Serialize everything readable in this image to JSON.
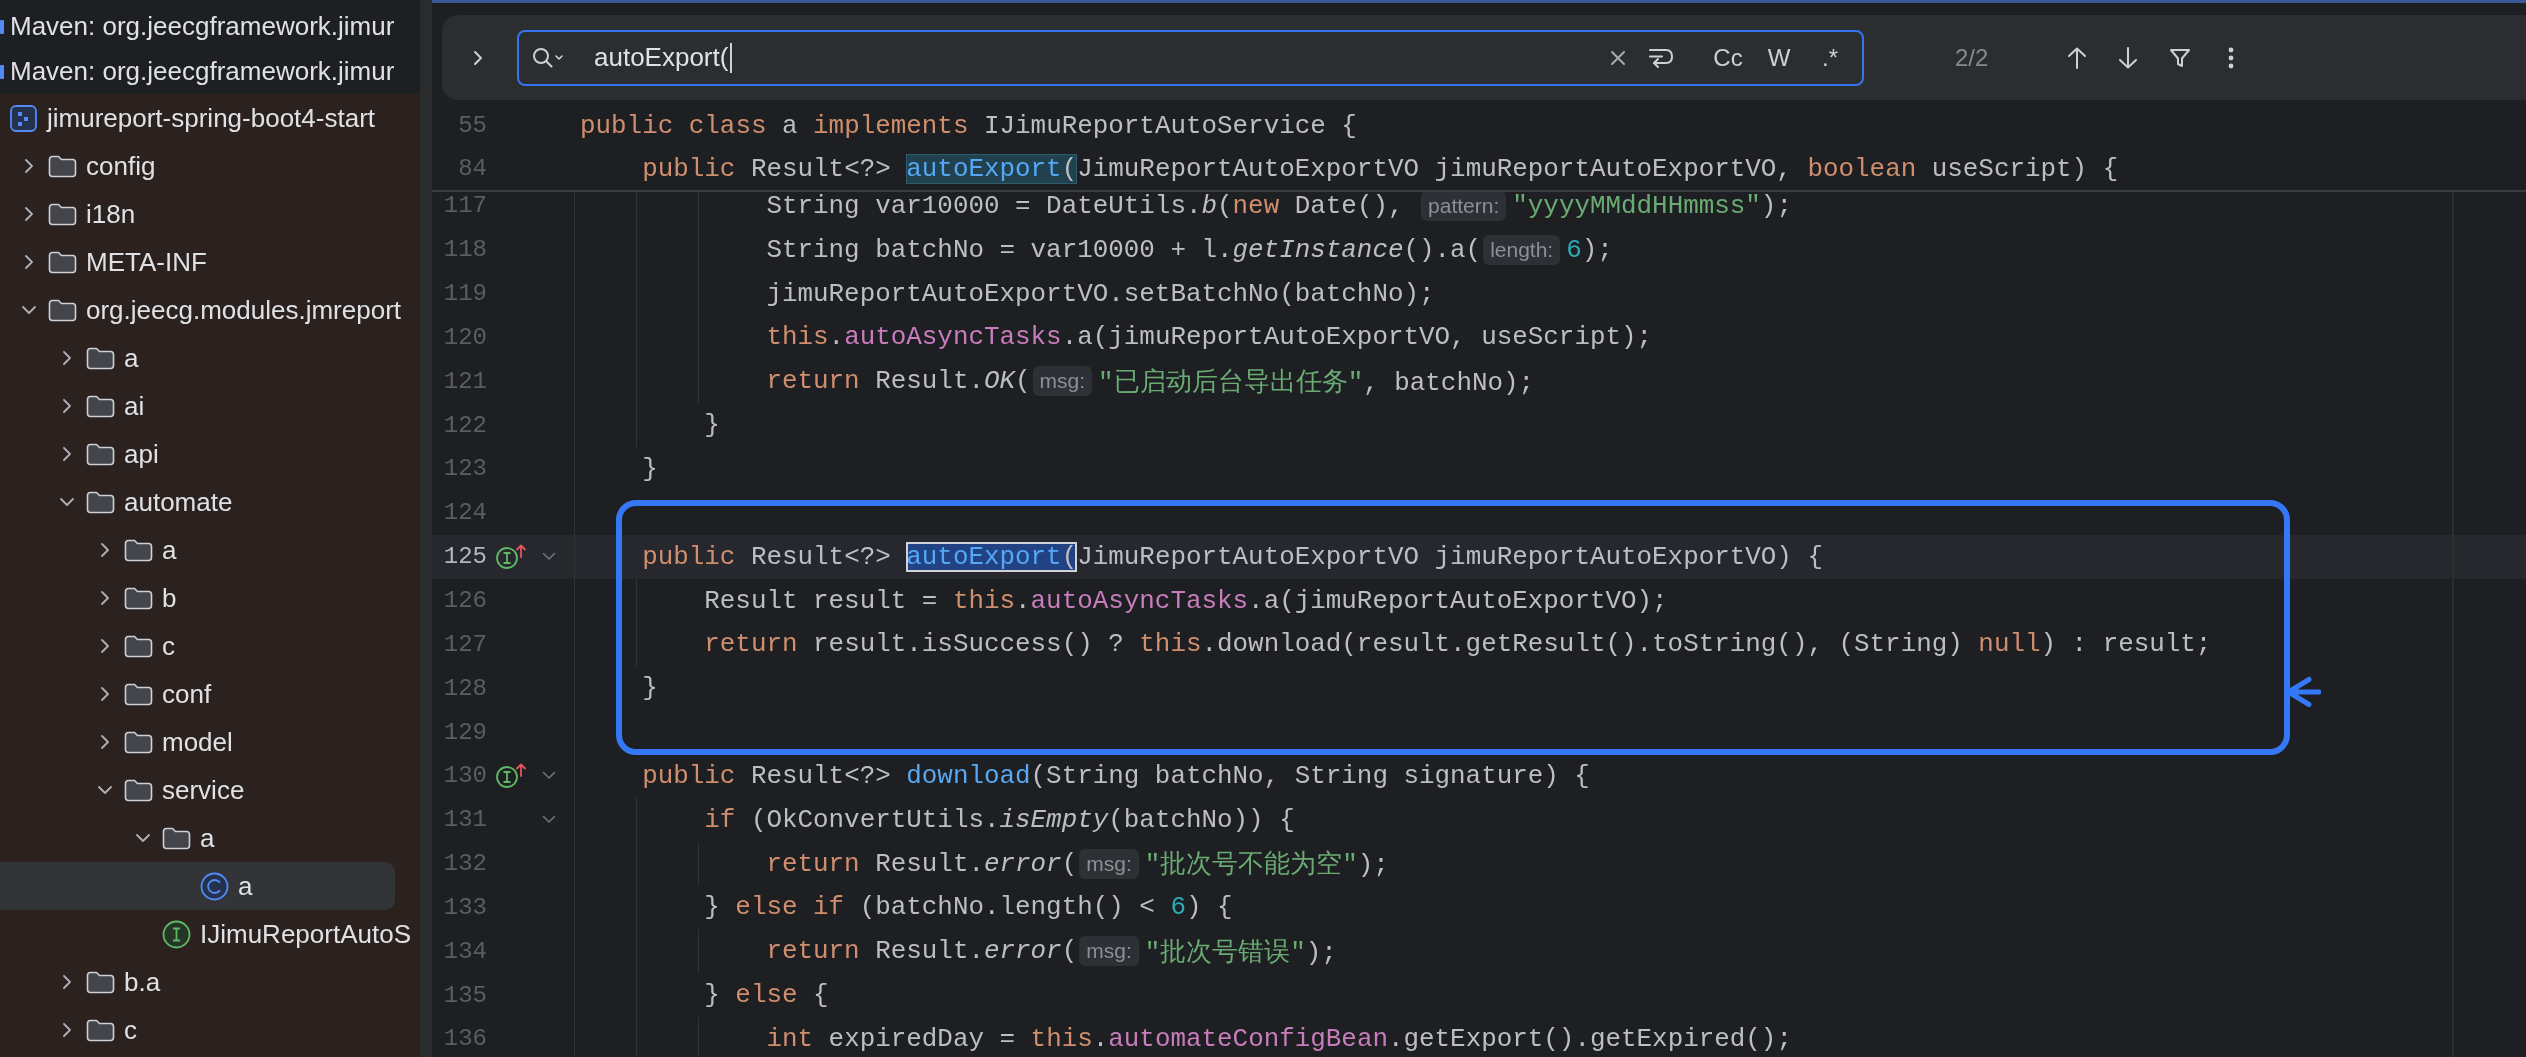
{
  "sidebar": {
    "items": [
      {
        "kind": "library",
        "label": "Maven: org.jeecgframework.jimur",
        "selected": false
      },
      {
        "kind": "library",
        "label": "Maven: org.jeecgframework.jimur",
        "selected": false,
        "children": [
          {
            "kind": "archive",
            "label": "jimureport-spring-boot4-start",
            "selected": false,
            "color": "#2b2220",
            "children": [
              {
                "kind": "folder",
                "label": "config",
                "expanded": false,
                "selected": false
              },
              {
                "kind": "folder",
                "label": "i18n",
                "expanded": false,
                "selected": false
              },
              {
                "kind": "folder",
                "label": "META-INF",
                "expanded": false,
                "selected": false
              },
              {
                "kind": "folder",
                "label": "org.jeecg.modules.jmreport",
                "expanded": true,
                "selected": false,
                "children": [
                  {
                    "kind": "folder",
                    "label": "a",
                    "expanded": false,
                    "selected": false
                  },
                  {
                    "kind": "folder",
                    "label": "ai",
                    "expanded": false,
                    "selected": false
                  },
                  {
                    "kind": "folder",
                    "label": "api",
                    "expanded": false,
                    "selected": false
                  },
                  {
                    "kind": "folder",
                    "label": "automate",
                    "expanded": true,
                    "selected": false,
                    "children": [
                      {
                        "kind": "folder",
                        "label": "a",
                        "expanded": false,
                        "selected": false
                      },
                      {
                        "kind": "folder",
                        "label": "b",
                        "expanded": false,
                        "selected": false
                      },
                      {
                        "kind": "folder",
                        "label": "c",
                        "expanded": false,
                        "selected": false
                      },
                      {
                        "kind": "folder",
                        "label": "conf",
                        "expanded": false,
                        "selected": false
                      },
                      {
                        "kind": "folder",
                        "label": "model",
                        "expanded": false,
                        "selected": false
                      },
                      {
                        "kind": "folder",
                        "label": "service",
                        "expanded": true,
                        "selected": false,
                        "children": [
                          {
                            "kind": "folder",
                            "label": "a",
                            "expanded": true,
                            "selected": false,
                            "children": [
                              {
                                "kind": "class",
                                "label": "a",
                                "selected": true
                              }
                            ]
                          },
                          {
                            "kind": "interface",
                            "label": "IJimuReportAutoS",
                            "selected": false
                          }
                        ]
                      }
                    ]
                  },
                  {
                    "kind": "folder",
                    "label": "b.a",
                    "expanded": false,
                    "selected": false
                  },
                  {
                    "kind": "folder",
                    "label": "c",
                    "expanded": false,
                    "selected": false
                  }
                ]
              }
            ]
          }
        ]
      }
    ]
  },
  "find_bar": {
    "query": "autoExport(",
    "options": [
      {
        "label": "Cc",
        "selected": false
      },
      {
        "label": "W",
        "selected": false
      },
      {
        "label": ".*",
        "selected": false
      }
    ],
    "counter": "2/2"
  },
  "editor": {
    "sticky_lines": [
      {
        "number": "55",
        "tokens": [
          {
            "kind": "keyword",
            "text": "public "
          },
          {
            "kind": "keyword",
            "text": "class"
          },
          {
            "kind": "plain",
            "text": " a "
          },
          {
            "kind": "keyword",
            "text": "implements"
          },
          {
            "kind": "plain",
            "text": " IJimuReportAutoService {"
          }
        ]
      },
      {
        "number": "84",
        "tokens": [
          {
            "kind": "keyword",
            "text": "    public"
          },
          {
            "kind": "plain",
            "text": " Result<?> "
          },
          {
            "kind": "match",
            "current": false,
            "parts": [
              {
                "kind": "declaration",
                "text": "autoExport"
              },
              {
                "kind": "plain",
                "text": "("
              }
            ]
          },
          {
            "kind": "plain",
            "text": "JimuReportAutoExportVO jimuReportAutoExportVO, "
          },
          {
            "kind": "keyword",
            "text": "boolean"
          },
          {
            "kind": "plain",
            "text": " useScript) {"
          }
        ]
      }
    ],
    "blocks": [
      {
        "kind": "plain",
        "lines": [
          {
            "number": "117",
            "current": false,
            "tokens": [
              {
                "kind": "plain",
                "text": "            String var10000 = DateUtils."
              },
              {
                "kind": "static",
                "text": "b"
              },
              {
                "kind": "plain",
                "text": "("
              },
              {
                "kind": "keyword",
                "text": "new"
              },
              {
                "kind": "plain",
                "text": " Date(), "
              },
              {
                "kind": "hint",
                "text": "pattern:"
              },
              {
                "kind": "string",
                "text": "\"yyyyMMddHHmmss\""
              },
              {
                "kind": "plain",
                "text": ");"
              }
            ]
          },
          {
            "number": "118",
            "current": false,
            "tokens": [
              {
                "kind": "plain",
                "text": "            String batchNo = var10000 + l."
              },
              {
                "kind": "static",
                "text": "getInstance"
              },
              {
                "kind": "plain",
                "text": "().a("
              },
              {
                "kind": "hint",
                "text": "length:"
              },
              {
                "kind": "number",
                "text": "6"
              },
              {
                "kind": "plain",
                "text": ");"
              }
            ]
          },
          {
            "number": "119",
            "current": false,
            "tokens": [
              {
                "kind": "plain",
                "text": "            jimuReportAutoExportVO.setBatchNo(batchNo);"
              }
            ]
          },
          {
            "number": "120",
            "current": false,
            "tokens": [
              {
                "kind": "keyword",
                "text": "            this"
              },
              {
                "kind": "plain",
                "text": "."
              },
              {
                "kind": "field",
                "text": "autoAsyncTasks"
              },
              {
                "kind": "plain",
                "text": ".a(jimuReportAutoExportVO, useScript);"
              }
            ]
          },
          {
            "number": "121",
            "current": false,
            "tokens": [
              {
                "kind": "keyword",
                "text": "            return"
              },
              {
                "kind": "plain",
                "text": " Result."
              },
              {
                "kind": "static",
                "text": "OK"
              },
              {
                "kind": "plain",
                "text": "("
              },
              {
                "kind": "hint",
                "text": "msg:"
              },
              {
                "kind": "string",
                "text": "\"已启动后台导出任务\""
              },
              {
                "kind": "plain",
                "text": ", batchNo);"
              }
            ]
          },
          {
            "number": "122",
            "current": false,
            "tokens": [
              {
                "kind": "plain",
                "text": "        }"
              }
            ]
          },
          {
            "number": "123",
            "current": false,
            "tokens": [
              {
                "kind": "plain",
                "text": "    }"
              }
            ]
          }
        ]
      },
      {
        "kind": "annotated",
        "lines": [
          {
            "number": "124",
            "current": false
          },
          {
            "number": "125",
            "current": true,
            "markers": [
              {
                "kind": "implements"
              },
              {
                "kind": "fold"
              }
            ],
            "tokens": [
              {
                "kind": "keyword",
                "text": "    public"
              },
              {
                "kind": "plain",
                "text": " Result<?> "
              },
              {
                "kind": "match",
                "current": true,
                "parts": [
                  {
                    "kind": "declaration",
                    "text": "autoExport"
                  },
                  {
                    "kind": "plain",
                    "text": "("
                  }
                ]
              },
              {
                "kind": "plain",
                "text": "JimuReportAutoExportVO jimuReportAutoExportVO) {"
              }
            ]
          },
          {
            "number": "126",
            "current": false,
            "tokens": [
              {
                "kind": "plain",
                "text": "        Result result = "
              },
              {
                "kind": "keyword",
                "text": "this"
              },
              {
                "kind": "plain",
                "text": "."
              },
              {
                "kind": "field",
                "text": "autoAsyncTasks"
              },
              {
                "kind": "plain",
                "text": ".a(jimuReportAutoExportVO);"
              }
            ]
          },
          {
            "number": "127",
            "current": false,
            "tokens": [
              {
                "kind": "keyword",
                "text": "        return"
              },
              {
                "kind": "plain",
                "text": " result.isSuccess() ? "
              },
              {
                "kind": "keyword",
                "text": "this"
              },
              {
                "kind": "plain",
                "text": ".download(result.getResult().toString(), (String) "
              },
              {
                "kind": "keyword",
                "text": "null"
              },
              {
                "kind": "plain",
                "text": ") : result;"
              }
            ]
          },
          {
            "number": "128",
            "current": false,
            "tokens": [
              {
                "kind": "plain",
                "text": "    }"
              }
            ]
          },
          {
            "number": "129",
            "current": false
          }
        ]
      },
      {
        "kind": "plain",
        "lines": [
          {
            "number": "130",
            "current": false,
            "markers": [
              {
                "kind": "implements"
              },
              {
                "kind": "fold"
              }
            ],
            "tokens": [
              {
                "kind": "keyword",
                "text": "    public"
              },
              {
                "kind": "plain",
                "text": " Result<?> "
              },
              {
                "kind": "declaration",
                "text": "download"
              },
              {
                "kind": "plain",
                "text": "(String batchNo, String signature) {"
              }
            ]
          },
          {
            "number": "131",
            "current": false,
            "markers": [
              {
                "kind": "fold"
              }
            ],
            "tokens": [
              {
                "kind": "keyword",
                "text": "        if"
              },
              {
                "kind": "plain",
                "text": " (OkConvertUtils."
              },
              {
                "kind": "static",
                "text": "isEmpty"
              },
              {
                "kind": "plain",
                "text": "(batchNo)) {"
              }
            ]
          },
          {
            "number": "132",
            "current": false,
            "tokens": [
              {
                "kind": "keyword",
                "text": "            return"
              },
              {
                "kind": "plain",
                "text": " Result."
              },
              {
                "kind": "static",
                "text": "error"
              },
              {
                "kind": "plain",
                "text": "("
              },
              {
                "kind": "hint",
                "text": "msg:"
              },
              {
                "kind": "string",
                "text": "\"批次号不能为空\""
              },
              {
                "kind": "plain",
                "text": ");"
              }
            ]
          },
          {
            "number": "133",
            "current": false,
            "tokens": [
              {
                "kind": "plain",
                "text": "        } "
              },
              {
                "kind": "keyword",
                "text": "else if"
              },
              {
                "kind": "plain",
                "text": " (batchNo.length() < "
              },
              {
                "kind": "number",
                "text": "6"
              },
              {
                "kind": "plain",
                "text": ") {"
              }
            ]
          },
          {
            "number": "134",
            "current": false,
            "tokens": [
              {
                "kind": "keyword",
                "text": "            return"
              },
              {
                "kind": "plain",
                "text": " Result."
              },
              {
                "kind": "static",
                "text": "error"
              },
              {
                "kind": "plain",
                "text": "("
              },
              {
                "kind": "hint",
                "text": "msg:"
              },
              {
                "kind": "string",
                "text": "\"批次号错误\""
              },
              {
                "kind": "plain",
                "text": ");"
              }
            ]
          },
          {
            "number": "135",
            "current": false,
            "tokens": [
              {
                "kind": "plain",
                "text": "        } "
              },
              {
                "kind": "keyword",
                "text": "else"
              },
              {
                "kind": "plain",
                "text": " {"
              }
            ]
          },
          {
            "number": "136",
            "current": false,
            "tokens": [
              {
                "kind": "keyword",
                "text": "            int"
              },
              {
                "kind": "plain",
                "text": " expiredDay = "
              },
              {
                "kind": "keyword",
                "text": "this"
              },
              {
                "kind": "plain",
                "text": "."
              },
              {
                "kind": "field",
                "text": "automateConfigBean"
              },
              {
                "kind": "plain",
                "text": ".getExport().getExpired();"
              }
            ]
          }
        ]
      }
    ]
  }
}
